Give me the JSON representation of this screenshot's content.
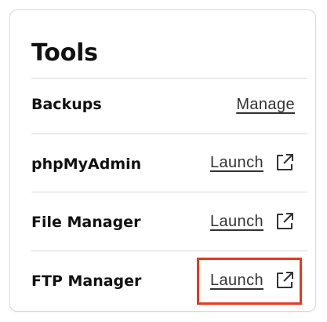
{
  "card": {
    "title": "Tools",
    "rows": [
      {
        "label": "Backups",
        "action": "Manage",
        "icon": null
      },
      {
        "label": "phpMyAdmin",
        "action": "Launch",
        "icon": "external-link-icon"
      },
      {
        "label": "File Manager",
        "action": "Launch",
        "icon": "external-link-icon"
      },
      {
        "label": "FTP Manager",
        "action": "Launch",
        "icon": "external-link-icon"
      }
    ]
  },
  "highlight": {
    "color": "#e8391c",
    "target": "FTP Manager Launch"
  }
}
